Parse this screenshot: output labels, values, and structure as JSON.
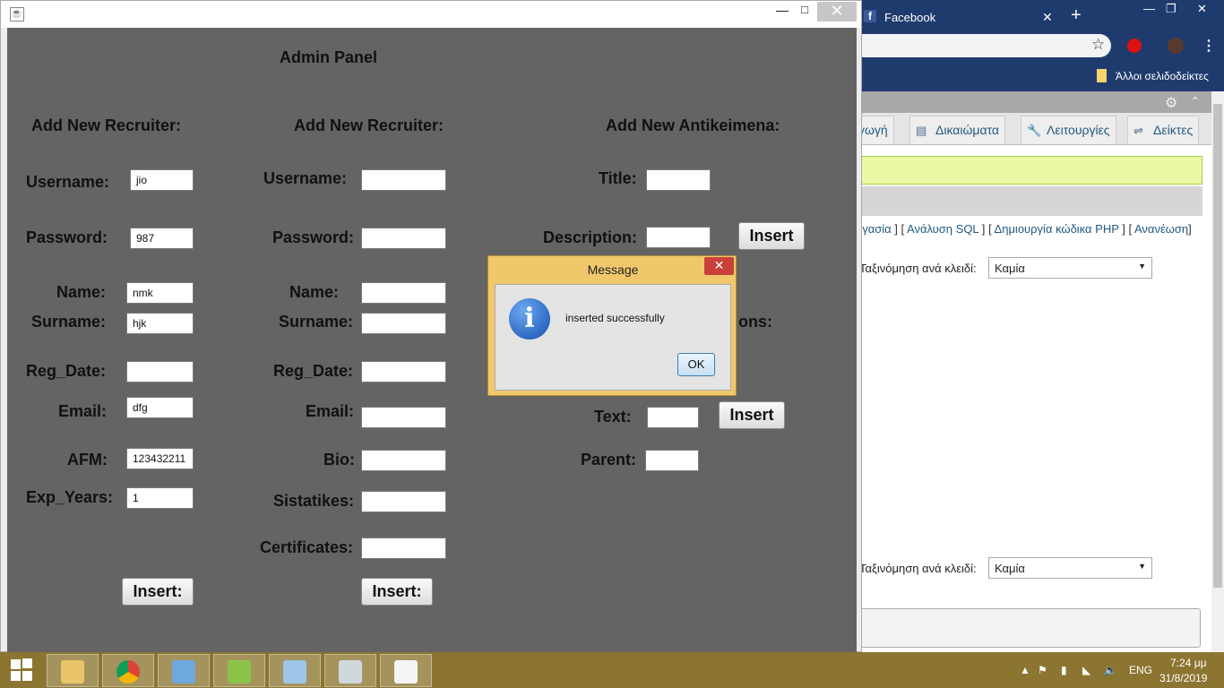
{
  "browser": {
    "tab_title": "Facebook",
    "tab_close": "✕",
    "new_tab": "+",
    "bookmarks_label": "Άλλοι σελιδοδείκτες"
  },
  "phpmyadmin": {
    "tabs": [
      {
        "label": "γωγή",
        "icon": "import-icon"
      },
      {
        "label": "Δικαιώματα",
        "icon": "privileges-icon"
      },
      {
        "label": "Λειτουργίες",
        "icon": "wrench-icon"
      },
      {
        "label": "Δείκτες",
        "icon": "triggers-icon"
      }
    ],
    "links": {
      "pre": "ογασία",
      "sep1": " ] [ ",
      "sql": "Ανάλυση SQL",
      "sep2": " ] [ ",
      "php": "Δημιουργία κώδικα PHP",
      "sep3": " ] [ ",
      "refresh": "Ανανέωση",
      "end": "]"
    },
    "sort_label_1": "Ταξινόμηση ανά κλειδί:",
    "sort_value_1": "Καμία",
    "sort_label_2": "Ταξινόμηση ανά κλειδί:",
    "sort_value_2": "Καμία",
    "stray": "ί"
  },
  "app": {
    "title": "Admin Panel",
    "col1": {
      "heading": "Add New Recruiter:",
      "username_label": "Username:",
      "username_value": "jio",
      "password_label": "Password:",
      "password_value": "987",
      "name_label": "Name:",
      "name_value": "nmk",
      "surname_label": "Surname:",
      "surname_value": "hjk",
      "regdate_label": "Reg_Date:",
      "regdate_value": "",
      "email_label": "Email:",
      "email_value": "dfg",
      "afm_label": "AFM:",
      "afm_value": "123432211",
      "exp_label": "Exp_Years:",
      "exp_value": "1",
      "insert_label": "Insert:"
    },
    "col2": {
      "heading": "Add New Recruiter:",
      "username_label": "Username:",
      "password_label": "Password:",
      "name_label": "Name:",
      "surname_label": "Surname:",
      "regdate_label": "Reg_Date:",
      "email_label": "Email:",
      "bio_label": "Bio:",
      "sistatikes_label": "Sistatikes:",
      "certificates_label": "Certificates:",
      "insert_label": "Insert:"
    },
    "col3": {
      "heading": "Add New Antikeimena:",
      "title_label": "Title:",
      "description_label": "Description:",
      "insert1_label": "Insert",
      "partial_label": "ons:",
      "text_label": "Text:",
      "insert2_label": "Insert",
      "parent_label": "Parent:"
    }
  },
  "dialog": {
    "title": "Message",
    "close": "✕",
    "message": "inserted successfully",
    "ok": "OK",
    "icon": "info-icon"
  },
  "taskbar": {
    "lang": "ENG",
    "time": "7:24 μμ",
    "date": "31/8/2019"
  },
  "colors": {
    "panel_bg": "#646464",
    "taskbar": "#8c7531",
    "dialog_frame": "#f0c86b",
    "browser_chrome": "#1f3b6e"
  }
}
